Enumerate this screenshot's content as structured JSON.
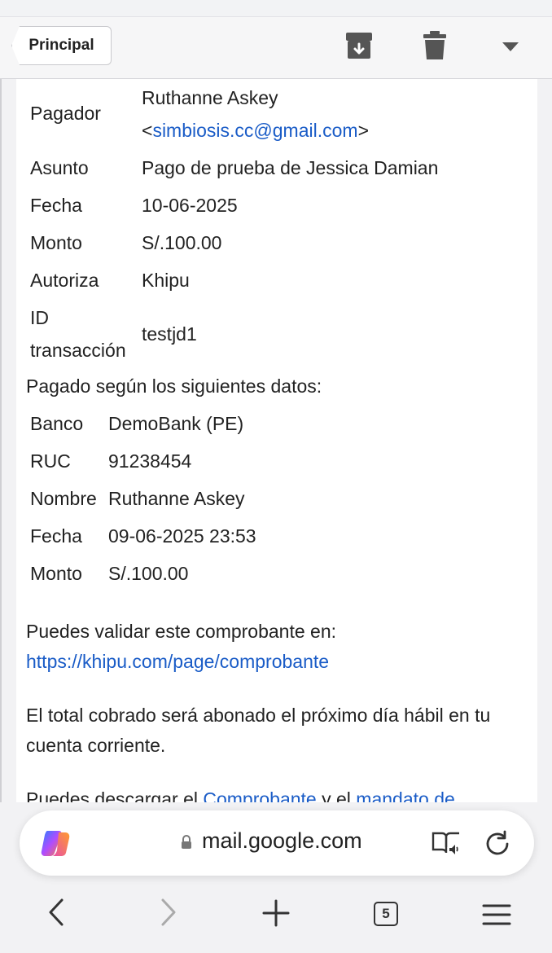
{
  "toolbar": {
    "back_label": "Principal",
    "icons": [
      "archive-icon",
      "trash-icon",
      "dropdown-arrow-icon"
    ]
  },
  "payment": {
    "payer_label": "Pagador",
    "payer_name": "Ruthanne Askey",
    "payer_email": "simbiosis.cc@gmail.com",
    "subject_label": "Asunto",
    "subject_value": "Pago de prueba de Jessica Damian",
    "date_label": "Fecha",
    "date_value": "10-06-2025",
    "amount_label": "Monto",
    "amount_value": "S/.100.00",
    "authorized_label": "Autoriza",
    "authorized_value": "Khipu",
    "txid_label_1": "ID",
    "txid_label_2": "transacción",
    "txid_value": "testjd1"
  },
  "paid_heading": "Pagado según los siguientes datos:",
  "bank": {
    "bank_label": "Banco",
    "bank_value": "DemoBank (PE)",
    "ruc_label": "RUC",
    "ruc_value": "91238454",
    "name_label": "Nombre",
    "name_value": "Ruthanne Askey",
    "date_label": "Fecha",
    "date_value": "09-06-2025 23:53",
    "amount_label": "Monto",
    "amount_value": "S/.100.00"
  },
  "validate_text": "Puedes validar este comprobante en:",
  "validate_link": "https://khipu.com/page/comprobante",
  "total_text": "El total cobrado será abonado el próximo día hábil en tu cuenta corriente.",
  "download_text_1": "Puedes descargar el ",
  "download_link_1": "Comprobante",
  "download_text_2": " y el ",
  "download_link_2": "mandato de",
  "browser": {
    "url": "mail.google.com",
    "tab_count": "5"
  },
  "colors": {
    "link": "#1a5cc7",
    "page_bg": "#f2f2f4"
  }
}
